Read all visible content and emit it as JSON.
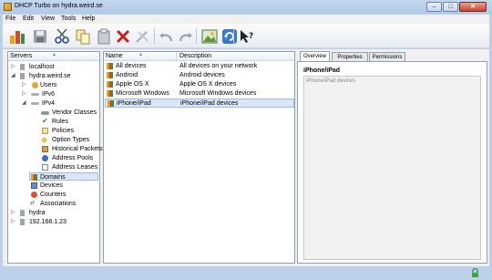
{
  "window": {
    "title": "DHCP Turbo on hydra.weird.se",
    "minimize_glyph": "–",
    "maximize_glyph": "□",
    "close_glyph": "✕"
  },
  "menu": [
    "File",
    "Edit",
    "View",
    "Tools",
    "Help"
  ],
  "toolbar": {
    "buttons": [
      "app-server-icon",
      "save-icon",
      "cut-icon",
      "copy-icon",
      "paste-icon",
      "delete-icon",
      "tools-icon",
      "undo-icon",
      "redo-icon",
      "picture-icon",
      "refresh-icon",
      "help-icon"
    ]
  },
  "servers": {
    "header": "Servers",
    "items": [
      {
        "label": "localhost"
      },
      {
        "label": "hydra.weird.se"
      },
      {
        "label": "Users"
      },
      {
        "label": "IPv6"
      },
      {
        "label": "IPv4"
      },
      {
        "label": "Vendor Classes"
      },
      {
        "label": "Rules"
      },
      {
        "label": "Policies"
      },
      {
        "label": "Option Types"
      },
      {
        "label": "Historical Packets"
      },
      {
        "label": "Address Pools"
      },
      {
        "label": "Address Leases"
      },
      {
        "label": "Domains"
      },
      {
        "label": "Devices"
      },
      {
        "label": "Counters"
      },
      {
        "label": "Associations"
      },
      {
        "label": "hydra"
      },
      {
        "label": "192.168.1.23"
      }
    ]
  },
  "list": {
    "columns": [
      "Name",
      "Description"
    ],
    "rows": [
      {
        "name": "All devices",
        "description": "All devices on your network"
      },
      {
        "name": "Android",
        "description": "Android devices"
      },
      {
        "name": "Apple OS X",
        "description": "Apple OS X devices"
      },
      {
        "name": "Microsoft Windows",
        "description": "Microsoft Windows devices"
      },
      {
        "name": "iPhone/iPad",
        "description": "iPhone/iPad devices"
      }
    ]
  },
  "detail": {
    "tabs": [
      "Overview",
      "Properties",
      "Permissions"
    ],
    "title": "iPhone/iPad",
    "description": "iPhone/iPad devices"
  },
  "colors": {
    "selection": "#dbe7f8",
    "selection_border": "#9dbde6",
    "frame": "#bcd0ea"
  }
}
